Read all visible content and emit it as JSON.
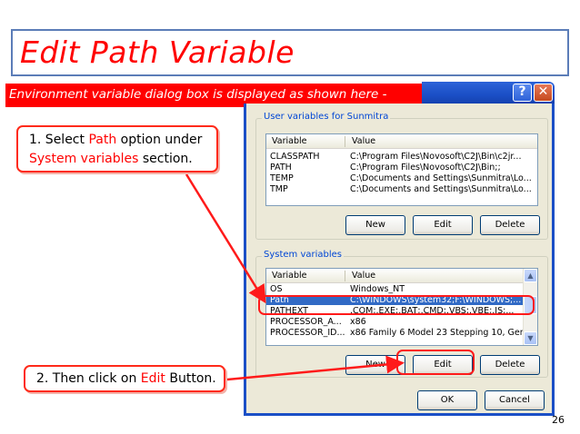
{
  "slide": {
    "title": "Edit Path Variable",
    "banner": "Environment variable dialog box is displayed as shown here -",
    "page_number": "26"
  },
  "dialog": {
    "help_button": "?",
    "close_button": "✕",
    "user_variables": {
      "group_label": "User variables for Sunmitra",
      "columns": [
        "Variable",
        "Value"
      ],
      "rows": [
        {
          "variable": "CLASSPATH",
          "value": "C:\\Program Files\\Novosoft\\C2J\\Bin\\c2jr..."
        },
        {
          "variable": "PATH",
          "value": "C:\\Program Files\\Novosoft\\C2J\\Bin;;"
        },
        {
          "variable": "TEMP",
          "value": "C:\\Documents and Settings\\Sunmitra\\Lo..."
        },
        {
          "variable": "TMP",
          "value": "C:\\Documents and Settings\\Sunmitra\\Lo..."
        }
      ],
      "buttons": {
        "new": "New",
        "edit": "Edit",
        "delete": "Delete"
      }
    },
    "system_variables": {
      "group_label": "System variables",
      "columns": [
        "Variable",
        "Value"
      ],
      "rows": [
        {
          "variable": "OS",
          "value": "Windows_NT"
        },
        {
          "variable": "Path",
          "value": "C:\\WINDOWS\\system32;F:\\WINDOWS;...",
          "selected": true
        },
        {
          "variable": "PATHEXT",
          "value": ".COM;.EXE;.BAT;.CMD;.VBS;.VBE;.JS;..."
        },
        {
          "variable": "PROCESSOR_A...",
          "value": "x86"
        },
        {
          "variable": "PROCESSOR_ID...",
          "value": "x86 Family 6 Model 23 Stepping 10, Gen..."
        }
      ],
      "buttons": {
        "new": "New",
        "edit": "Edit",
        "delete": "Delete"
      }
    },
    "ok_button": "OK",
    "cancel_button": "Cancel"
  },
  "callouts": {
    "step1": {
      "prefix": "1. Select ",
      "highlight1": "Path",
      "middle": " option under",
      "highlight2": "System variables",
      "suffix": " section."
    },
    "step2": {
      "prefix": "2. Then click on ",
      "highlight": "Edit",
      "suffix": " Button."
    }
  },
  "colors": {
    "accent_red": "#ff0000",
    "xp_title_blue": "#1b4fc6",
    "selection_blue": "#316ac5",
    "title_border": "#5b7db8"
  }
}
